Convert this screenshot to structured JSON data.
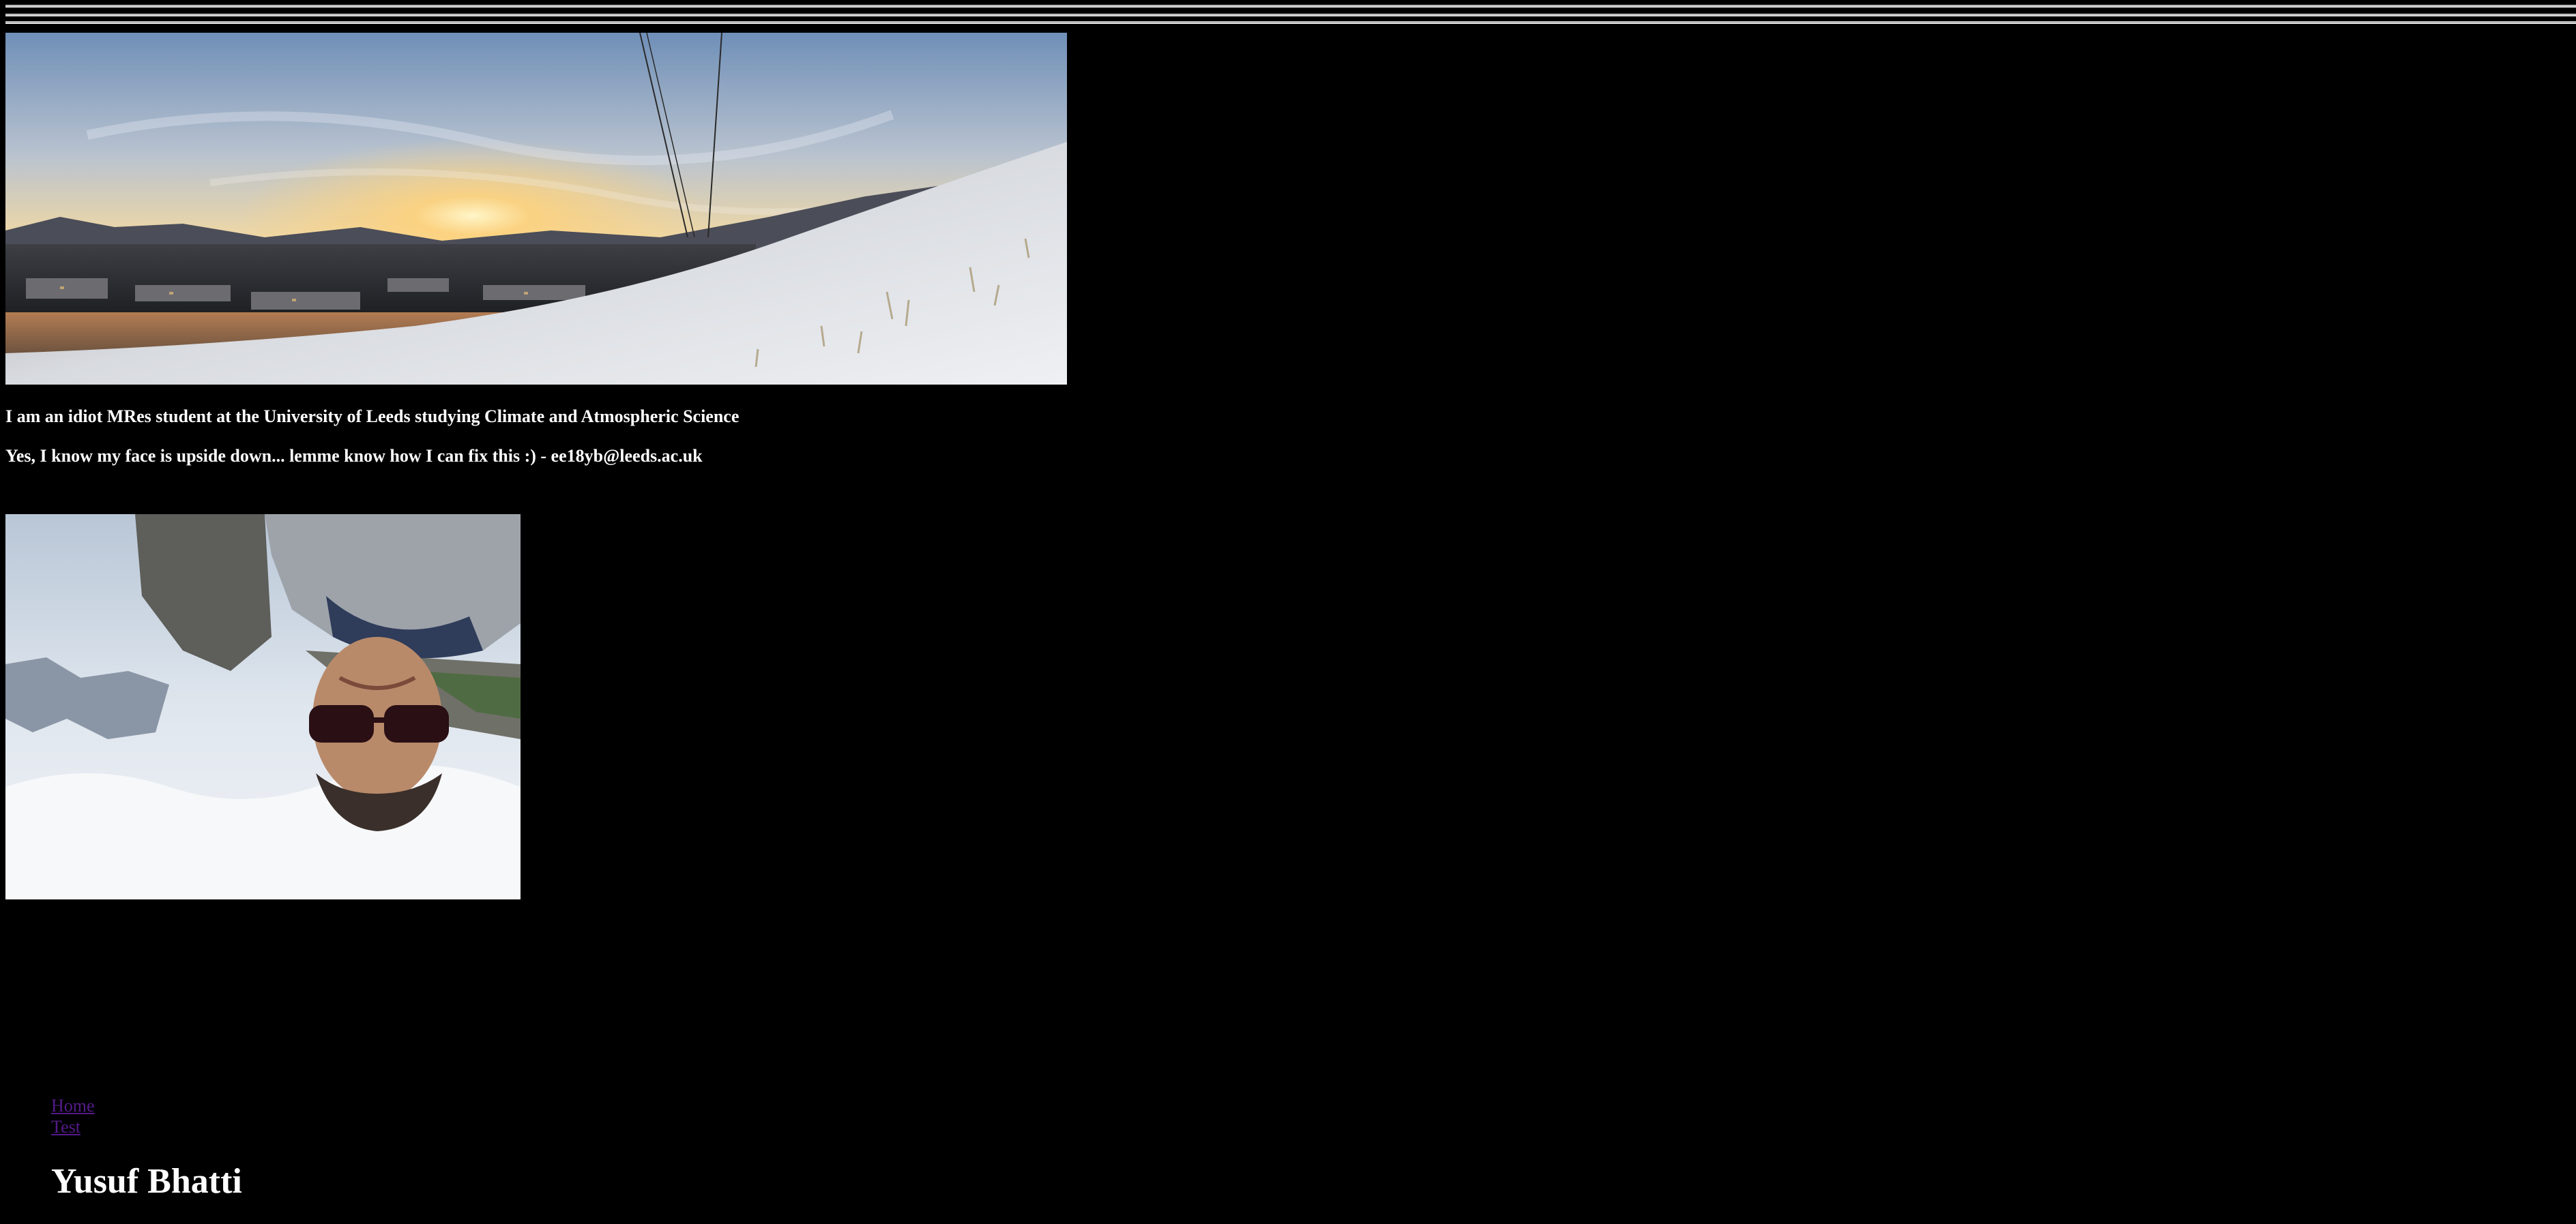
{
  "content": {
    "intro_line": "I am an idiot MRes student at the University of Leeds studying Climate and Atmospheric Science",
    "note_line": "Yes, I know my face is upside down... lemme know how I can fix this :) - ee18yb@leeds.ac.uk"
  },
  "nav": {
    "items": [
      {
        "label": "Home"
      },
      {
        "label": "Test"
      }
    ]
  },
  "site": {
    "title": "Yusuf Bhatti"
  },
  "images": {
    "banner": {
      "icon": "landscape-photo-icon"
    },
    "portrait": {
      "icon": "portrait-photo-icon",
      "note": ""
    }
  },
  "colors": {
    "background": "#000000",
    "text": "#ffffff",
    "link_visited": "#551a8b",
    "rule": "#bdbdbd"
  }
}
